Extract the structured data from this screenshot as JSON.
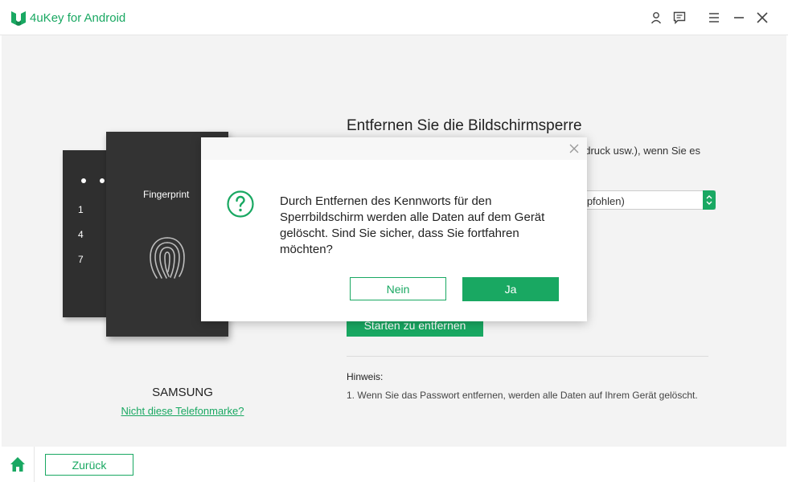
{
  "app": {
    "title": "4uKey for Android"
  },
  "titlebar": {
    "icons": [
      "user-icon",
      "feedback-icon",
      "menu-icon",
      "minimize-icon",
      "close-icon"
    ]
  },
  "device": {
    "keypad": [
      "1",
      "4",
      "7"
    ],
    "fingerprint_label": "Fingerprint",
    "brand": "SAMSUNG",
    "not_brand_link": "Nicht diese Telefonmarke?"
  },
  "main": {
    "heading": "Entfernen Sie die Bildschirmsperre",
    "description_visible": "bdruck usw.), wenn Sie es",
    "select_visible": "mpfohlen)",
    "start_button": "Starten zu entfernen",
    "hint_title": "Hinweis:",
    "hint_text": "1. Wenn Sie das Passwort entfernen, werden alle Daten auf Ihrem Gerät gelöscht."
  },
  "footer": {
    "back_button": "Zurück"
  },
  "dialog": {
    "message": "Durch Entfernen des Kennworts für den Sperrbildschirm werden alle Daten auf dem Gerät gelöscht. Sind Sie sicher, dass Sie fortfahren möchten?",
    "no_button": "Nein",
    "yes_button": "Ja"
  },
  "colors": {
    "accent": "#19a862",
    "phone": "#333333",
    "overlay_bg": "#f3f3f3"
  }
}
